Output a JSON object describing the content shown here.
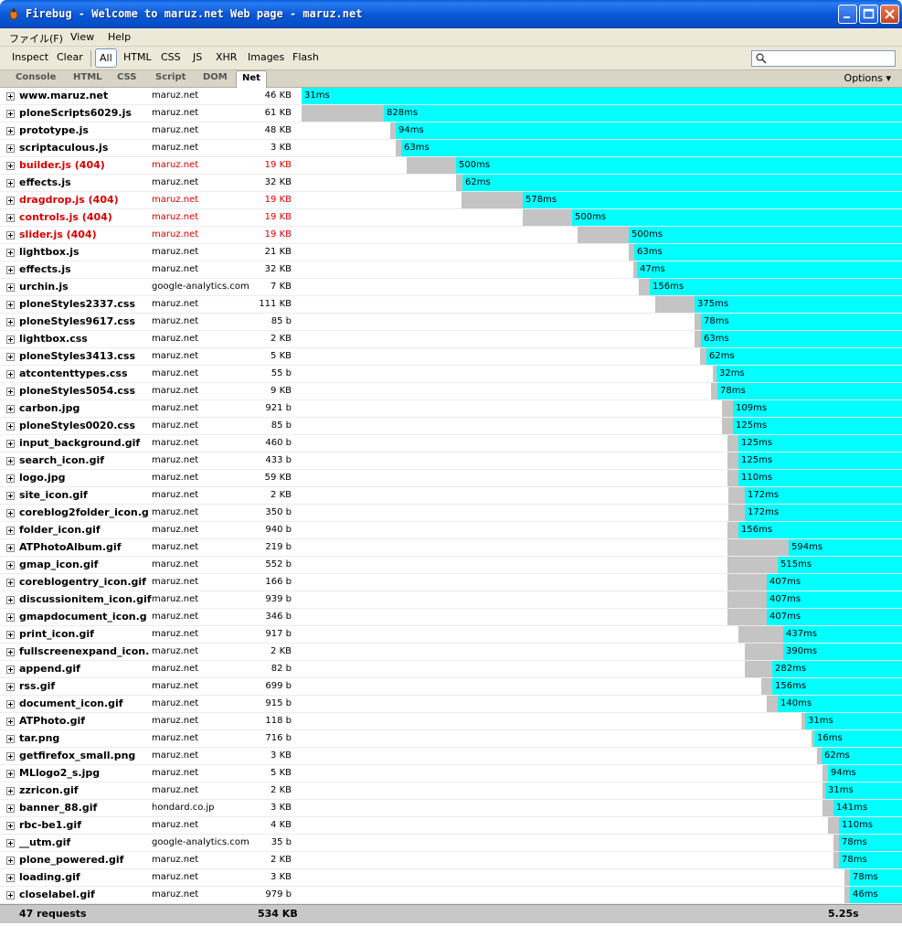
{
  "window": {
    "title": "Firebug - Welcome to maruz.net Web page - maruz.net"
  },
  "menu": [
    "ファイル(F)",
    "View",
    "Help"
  ],
  "toolbar": {
    "inspect": "Inspect",
    "clear": "Clear",
    "filters": [
      "All",
      "HTML",
      "CSS",
      "JS",
      "XHR",
      "Images",
      "Flash"
    ],
    "selected_filter": "All"
  },
  "tabs": [
    "Console",
    "HTML",
    "CSS",
    "Script",
    "DOM",
    "Net"
  ],
  "selected_tab": "Net",
  "options_label": "Options ▾",
  "requests": [
    {
      "name": "www.maruz.net",
      "domain": "maruz.net",
      "size": "46 KB",
      "time": "31ms",
      "error": false
    },
    {
      "name": "ploneScripts6029.js",
      "domain": "maruz.net",
      "size": "61 KB",
      "time": "828ms",
      "error": false
    },
    {
      "name": "prototype.js",
      "domain": "maruz.net",
      "size": "48 KB",
      "time": "94ms",
      "error": false
    },
    {
      "name": "scriptaculous.js",
      "domain": "maruz.net",
      "size": "3 KB",
      "time": "63ms",
      "error": false
    },
    {
      "name": "builder.js (404)",
      "domain": "maruz.net",
      "size": "19 KB",
      "time": "500ms",
      "error": true
    },
    {
      "name": "effects.js",
      "domain": "maruz.net",
      "size": "32 KB",
      "time": "62ms",
      "error": false
    },
    {
      "name": "dragdrop.js (404)",
      "domain": "maruz.net",
      "size": "19 KB",
      "time": "578ms",
      "error": true
    },
    {
      "name": "controls.js (404)",
      "domain": "maruz.net",
      "size": "19 KB",
      "time": "500ms",
      "error": true
    },
    {
      "name": "slider.js (404)",
      "domain": "maruz.net",
      "size": "19 KB",
      "time": "500ms",
      "error": true
    },
    {
      "name": "lightbox.js",
      "domain": "maruz.net",
      "size": "21 KB",
      "time": "63ms",
      "error": false
    },
    {
      "name": "effects.js",
      "domain": "maruz.net",
      "size": "32 KB",
      "time": "47ms",
      "error": false
    },
    {
      "name": "urchin.js",
      "domain": "google-analytics.com",
      "size": "7 KB",
      "time": "156ms",
      "error": false
    },
    {
      "name": "ploneStyles2337.css",
      "domain": "maruz.net",
      "size": "111 KB",
      "time": "375ms",
      "error": false
    },
    {
      "name": "ploneStyles9617.css",
      "domain": "maruz.net",
      "size": "85 b",
      "time": "78ms",
      "error": false
    },
    {
      "name": "lightbox.css",
      "domain": "maruz.net",
      "size": "2 KB",
      "time": "63ms",
      "error": false
    },
    {
      "name": "ploneStyles3413.css",
      "domain": "maruz.net",
      "size": "5 KB",
      "time": "62ms",
      "error": false
    },
    {
      "name": "atcontenttypes.css",
      "domain": "maruz.net",
      "size": "55 b",
      "time": "32ms",
      "error": false
    },
    {
      "name": "ploneStyles5054.css",
      "domain": "maruz.net",
      "size": "9 KB",
      "time": "78ms",
      "error": false
    },
    {
      "name": "carbon.jpg",
      "domain": "maruz.net",
      "size": "921 b",
      "time": "109ms",
      "error": false
    },
    {
      "name": "ploneStyles0020.css",
      "domain": "maruz.net",
      "size": "85 b",
      "time": "125ms",
      "error": false
    },
    {
      "name": "input_background.gif",
      "domain": "maruz.net",
      "size": "460 b",
      "time": "125ms",
      "error": false
    },
    {
      "name": "search_icon.gif",
      "domain": "maruz.net",
      "size": "433 b",
      "time": "125ms",
      "error": false
    },
    {
      "name": "logo.jpg",
      "domain": "maruz.net",
      "size": "59 KB",
      "time": "110ms",
      "error": false
    },
    {
      "name": "site_icon.gif",
      "domain": "maruz.net",
      "size": "2 KB",
      "time": "172ms",
      "error": false
    },
    {
      "name": "coreblog2folder_icon.g",
      "domain": "maruz.net",
      "size": "350 b",
      "time": "172ms",
      "error": false
    },
    {
      "name": "folder_icon.gif",
      "domain": "maruz.net",
      "size": "940 b",
      "time": "156ms",
      "error": false
    },
    {
      "name": "ATPhotoAlbum.gif",
      "domain": "maruz.net",
      "size": "219 b",
      "time": "594ms",
      "error": false
    },
    {
      "name": "gmap_icon.gif",
      "domain": "maruz.net",
      "size": "552 b",
      "time": "515ms",
      "error": false
    },
    {
      "name": "coreblogentry_icon.gif",
      "domain": "maruz.net",
      "size": "166 b",
      "time": "407ms",
      "error": false
    },
    {
      "name": "discussionitem_icon.gif",
      "domain": "maruz.net",
      "size": "939 b",
      "time": "407ms",
      "error": false
    },
    {
      "name": "gmapdocument_icon.g",
      "domain": "maruz.net",
      "size": "346 b",
      "time": "407ms",
      "error": false
    },
    {
      "name": "print_icon.gif",
      "domain": "maruz.net",
      "size": "917 b",
      "time": "437ms",
      "error": false
    },
    {
      "name": "fullscreenexpand_icon.",
      "domain": "maruz.net",
      "size": "2 KB",
      "time": "390ms",
      "error": false
    },
    {
      "name": "append.gif",
      "domain": "maruz.net",
      "size": "82 b",
      "time": "282ms",
      "error": false
    },
    {
      "name": "rss.gif",
      "domain": "maruz.net",
      "size": "699 b",
      "time": "156ms",
      "error": false
    },
    {
      "name": "document_icon.gif",
      "domain": "maruz.net",
      "size": "915 b",
      "time": "140ms",
      "error": false
    },
    {
      "name": "ATPhoto.gif",
      "domain": "maruz.net",
      "size": "118 b",
      "time": "31ms",
      "error": false
    },
    {
      "name": "tar.png",
      "domain": "maruz.net",
      "size": "716 b",
      "time": "16ms",
      "error": false
    },
    {
      "name": "getfirefox_small.png",
      "domain": "maruz.net",
      "size": "3 KB",
      "time": "62ms",
      "error": false
    },
    {
      "name": "MLlogo2_s.jpg",
      "domain": "maruz.net",
      "size": "5 KB",
      "time": "94ms",
      "error": false
    },
    {
      "name": "zzricon.gif",
      "domain": "maruz.net",
      "size": "2 KB",
      "time": "31ms",
      "error": false
    },
    {
      "name": "banner_88.gif",
      "domain": "hondard.co.jp",
      "size": "3 KB",
      "time": "141ms",
      "error": false
    },
    {
      "name": "rbc-be1.gif",
      "domain": "maruz.net",
      "size": "4 KB",
      "time": "110ms",
      "error": false
    },
    {
      "name": "__utm.gif",
      "domain": "google-analytics.com",
      "size": "35 b",
      "time": "78ms",
      "error": false
    },
    {
      "name": "plone_powered.gif",
      "domain": "maruz.net",
      "size": "2 KB",
      "time": "78ms",
      "error": false
    },
    {
      "name": "loading.gif",
      "domain": "maruz.net",
      "size": "3 KB",
      "time": "78ms",
      "error": false
    },
    {
      "name": "closelabel.gif",
      "domain": "maruz.net",
      "size": "979 b",
      "time": "46ms",
      "error": false
    }
  ],
  "summary": {
    "requests": "47 requests",
    "total_size": "534 KB",
    "total_time": "5.25s"
  }
}
